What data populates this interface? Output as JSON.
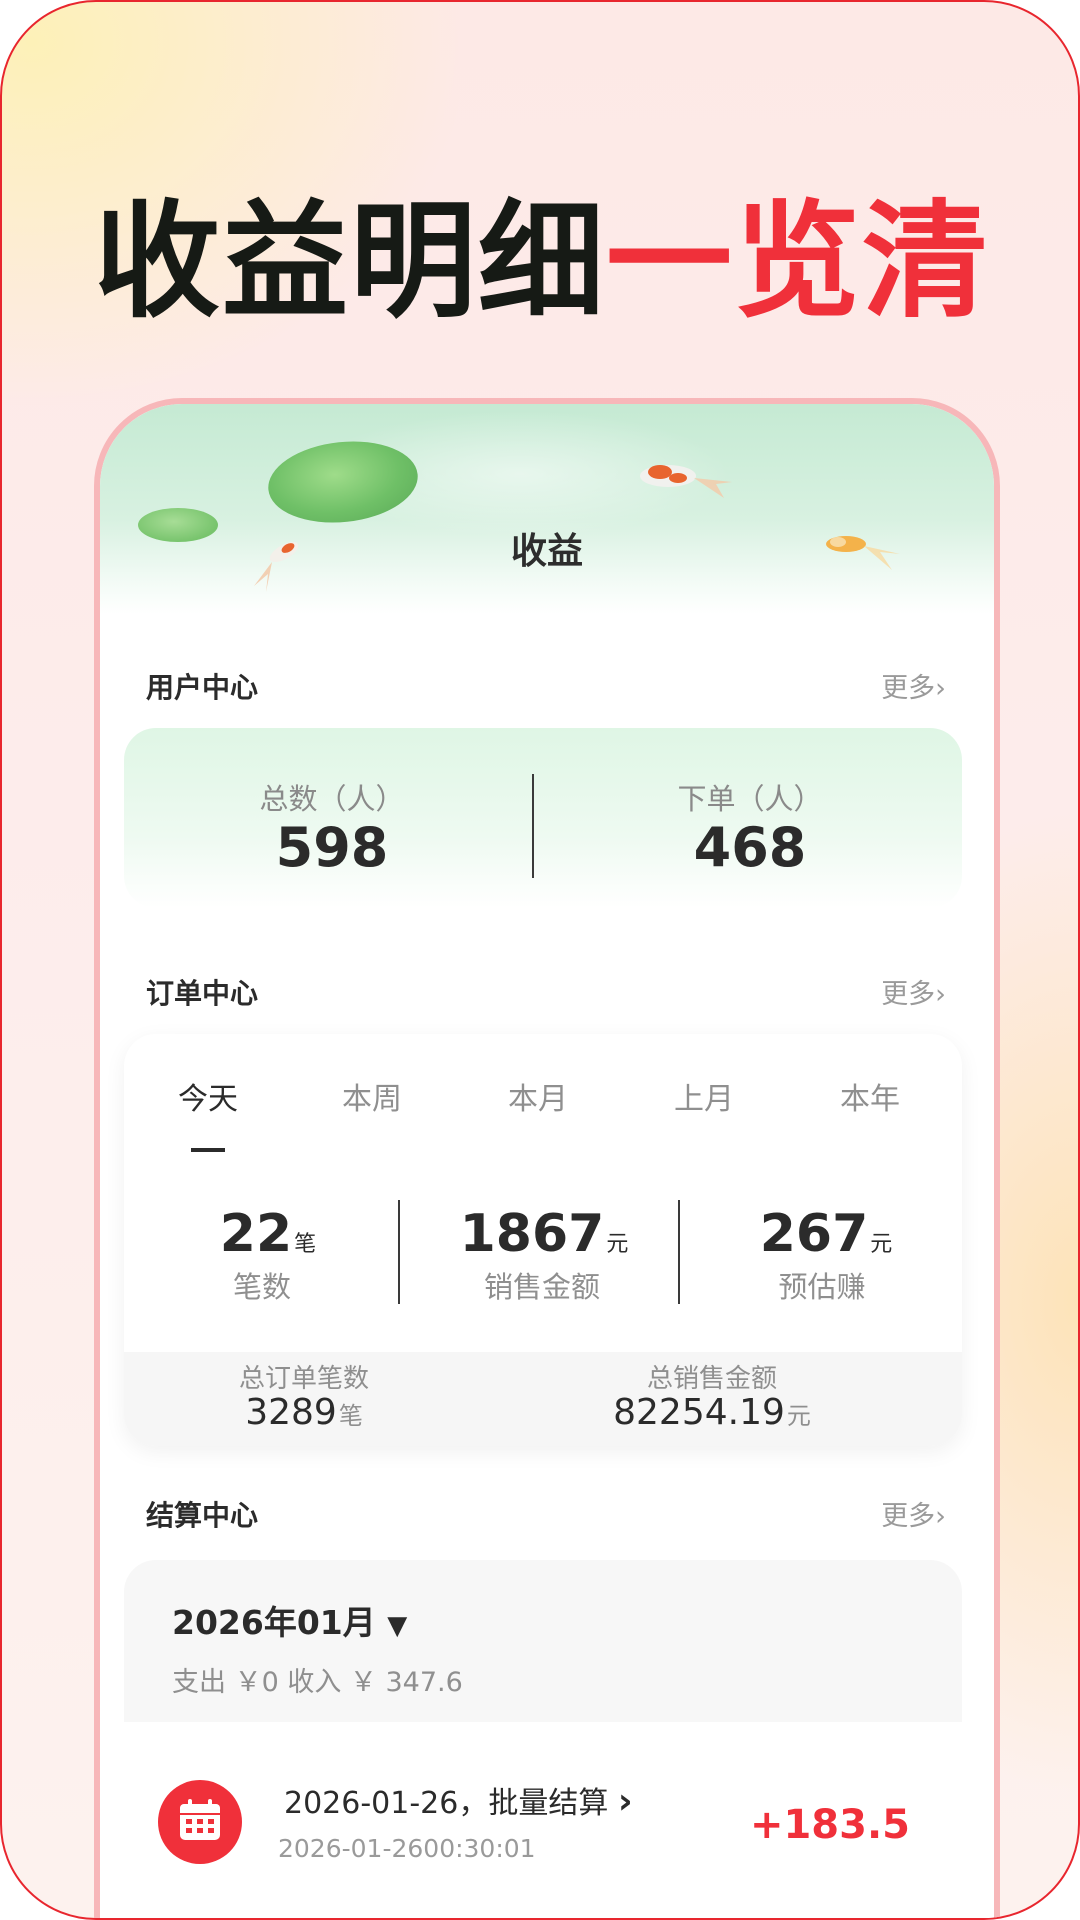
{
  "headline": {
    "part_dark": "收益明细",
    "part_red": "一览清"
  },
  "app": {
    "page_title": "收益"
  },
  "user_center": {
    "title": "用户中心",
    "more": "更多›",
    "total_label": "总数（人）",
    "total_value": "598",
    "ordered_label": "下单（人）",
    "ordered_value": "468"
  },
  "order_center": {
    "title": "订单中心",
    "more": "更多›",
    "tabs": [
      "今天",
      "本周",
      "本月",
      "上月",
      "本年"
    ],
    "active_tab": "今天",
    "count_value": "22",
    "count_unit": "笔",
    "count_label": "笔数",
    "sales_value": "1867",
    "sales_unit": "元",
    "sales_label": "销售金额",
    "earn_value": "267",
    "earn_unit": "元",
    "earn_label": "预估赚",
    "total_orders_label": "总订单笔数",
    "total_orders_value": "3289",
    "total_orders_unit": "笔",
    "total_sales_label": "总销售金额",
    "total_sales_value": "82254.19",
    "total_sales_unit": "元"
  },
  "settle_center": {
    "title": "结算中心",
    "more": "更多›",
    "month": "2026年01月",
    "month_arrow": "▼",
    "summary": "支出 ￥0 收入 ￥ 347.6",
    "items": [
      {
        "title": "2026-01-26，批量结算",
        "chevron": "›",
        "time": "2026-01-2600:30:01",
        "amount": "+183.5"
      }
    ]
  },
  "colors": {
    "accent_red": "#f0303a",
    "frame_border": "#e8262e",
    "phone_border": "#f7b7b9"
  }
}
